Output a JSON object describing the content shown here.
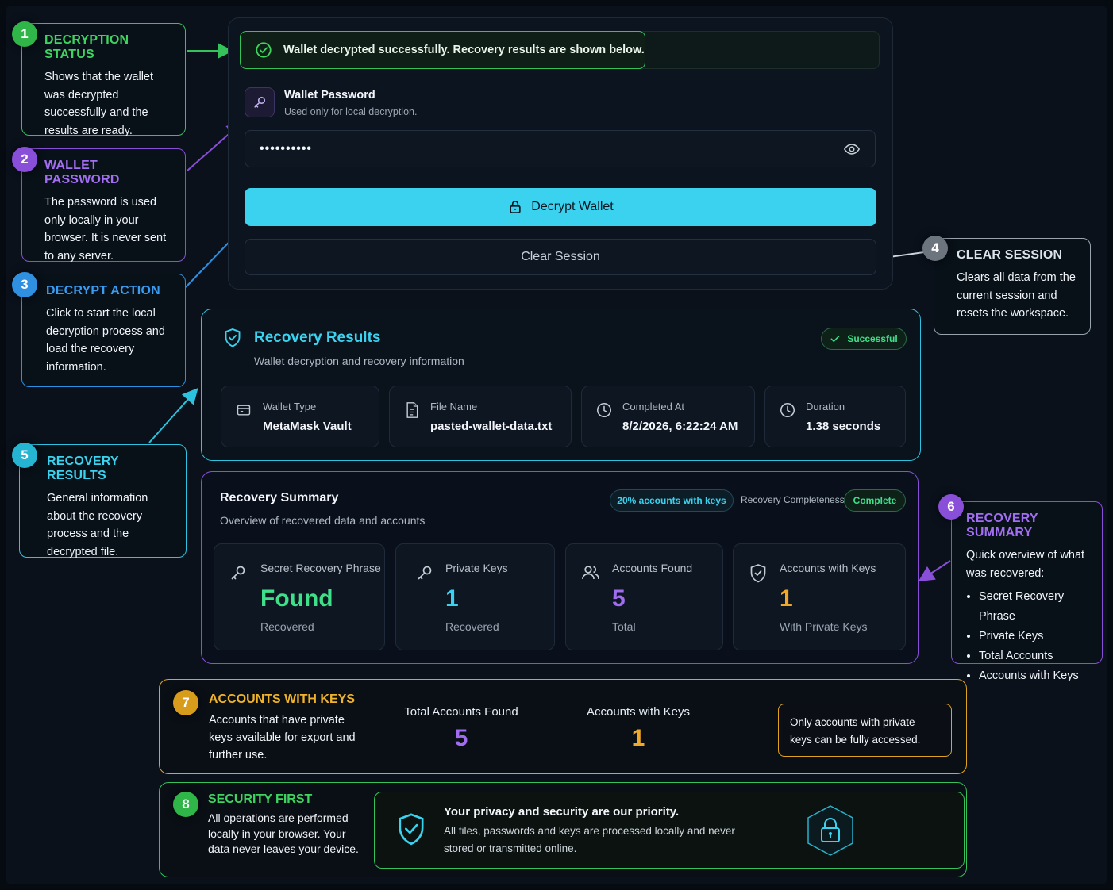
{
  "colors": {
    "green": "#35c25a",
    "purple": "#8a4fd8",
    "blue": "#2f8fe0",
    "cyan": "#2bc3df",
    "gold": "#e0a320",
    "accent_button": "#3ad2ee"
  },
  "callouts": {
    "c1": {
      "num": "1",
      "title": "DECRYPTION STATUS",
      "body": "Shows that the wallet was decrypted successfully and the results are ready."
    },
    "c2": {
      "num": "2",
      "title": "WALLET PASSWORD",
      "body": "The password is used only locally in your browser. It is never sent to any server."
    },
    "c3": {
      "num": "3",
      "title": "DECRYPT ACTION",
      "body": "Click to start the local decryption process and load the recovery information."
    },
    "c4": {
      "num": "4",
      "title": "CLEAR SESSION",
      "body": "Clears all data from the current session and resets the workspace."
    },
    "c5": {
      "num": "5",
      "title": "RECOVERY RESULTS",
      "body": "General information about the recovery process and the decrypted file."
    },
    "c6": {
      "num": "6",
      "title": "RECOVERY SUMMARY",
      "body": "Quick overview of what was recovered:",
      "items": [
        "Secret Recovery Phrase",
        "Private Keys",
        "Total Accounts",
        "Accounts with Keys"
      ]
    },
    "c7": {
      "num": "7",
      "title": "ACCOUNTS WITH KEYS",
      "body": "Accounts that have private keys available for export and further use.",
      "flow_total_label": "Total Accounts Found",
      "flow_total_value": "5",
      "flow_keys_label": "Accounts with Keys",
      "flow_keys_value": "1",
      "note": "Only accounts with private keys can be fully accessed."
    },
    "c8": {
      "num": "8",
      "title": "SECURITY FIRST",
      "body": "All operations are performed locally in your browser. Your data never leaves your device.",
      "banner_title": "Your privacy and security are our priority.",
      "banner_body": "All files, passwords and keys are processed locally and never stored or transmitted online."
    }
  },
  "status": {
    "message": "Wallet decrypted successfully. Recovery results are shown below.",
    "icon": "check-circle-icon"
  },
  "password": {
    "label": "Wallet Password",
    "hint": "Used only for local decryption.",
    "value": "••••••••••",
    "icon": "key-icon",
    "toggle_icon": "eye-icon"
  },
  "actions": {
    "decrypt_label": "Decrypt Wallet",
    "clear_label": "Clear Session"
  },
  "results": {
    "title": "Recovery Results",
    "subtitle": "Wallet decryption and recovery information",
    "status_badge": "Successful",
    "tiles": [
      {
        "label": "Wallet Type",
        "value": "MetaMask Vault",
        "icon": "wallet-icon"
      },
      {
        "label": "File Name",
        "value": "pasted-wallet-data.txt",
        "icon": "file-icon"
      },
      {
        "label": "Completed At",
        "value": "8/2/2026, 6:22:24 AM",
        "icon": "clock-icon"
      },
      {
        "label": "Duration",
        "value": "1.38 seconds",
        "icon": "clock-icon"
      }
    ]
  },
  "summary": {
    "title": "Recovery Summary",
    "subtitle": "Overview of recovered data and accounts",
    "keys_badge": "20% accounts with keys",
    "completeness_label": "Recovery Completeness:",
    "completeness_value": "Complete",
    "stats": [
      {
        "label": "Secret Recovery Phrase",
        "value": "Found",
        "sub": "Recovered",
        "color": "#3fe08a",
        "icon": "key-icon"
      },
      {
        "label": "Private Keys",
        "value": "1",
        "sub": "Recovered",
        "color": "#3ad2ee",
        "icon": "key-icon"
      },
      {
        "label": "Accounts Found",
        "value": "5",
        "sub": "Total",
        "color": "#a06cf0",
        "icon": "users-icon"
      },
      {
        "label": "Accounts with Keys",
        "value": "1",
        "sub": "With Private Keys",
        "color": "#f0a82a",
        "icon": "shield-icon"
      }
    ]
  }
}
